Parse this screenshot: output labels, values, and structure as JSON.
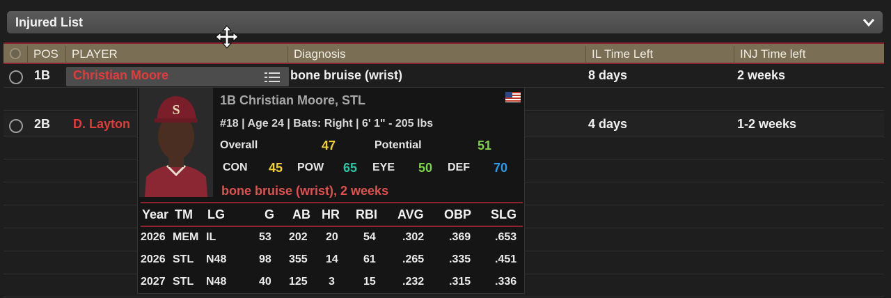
{
  "panel": {
    "title": "Injured List"
  },
  "columns": {
    "pos": "POS",
    "player": "PLAYER",
    "diagnosis": "Diagnosis",
    "il_time": "IL Time Left",
    "inj_time": "INJ Time left"
  },
  "rows": [
    {
      "pos": "1B",
      "player": "Christian Moore",
      "diagnosis": "bone bruise (wrist)",
      "il_time": "8 days",
      "inj_time": "2 weeks"
    },
    {
      "pos": "2B",
      "player": "D. Layton",
      "diagnosis": "",
      "il_time": "4 days",
      "inj_time": "1-2 weeks"
    }
  ],
  "card": {
    "name": "1B Christian Moore, STL",
    "info": "#18 | Age 24 | Bats: Right | 6' 1\" - 205 lbs",
    "overall_label": "Overall",
    "overall": "47",
    "potential_label": "Potential",
    "potential": "51",
    "con_label": "CON",
    "con": "45",
    "pow_label": "POW",
    "pow": "65",
    "eye_label": "EYE",
    "eye": "50",
    "def_label": "DEF",
    "def": "70",
    "injury": "bone bruise (wrist), 2 weeks",
    "colors": {
      "overall": "#f0d22e",
      "potential": "#7fd34a",
      "con": "#f0d22e",
      "pow": "#2ec4a4",
      "eye": "#7fd34a",
      "def": "#2f9be8"
    },
    "stats_headers": [
      "Year",
      "TM",
      "LG",
      "G",
      "AB",
      "HR",
      "RBI",
      "AVG",
      "OBP",
      "SLG"
    ],
    "stats_rows": [
      [
        "2026",
        "MEM",
        "IL",
        "53",
        "202",
        "20",
        "54",
        ".302",
        ".369",
        ".653"
      ],
      [
        "2026",
        "STL",
        "N48",
        "98",
        "355",
        "14",
        "61",
        ".265",
        ".335",
        ".451"
      ],
      [
        "2027",
        "STL",
        "N48",
        "40",
        "125",
        "3",
        "15",
        ".232",
        ".315",
        ".336"
      ]
    ]
  }
}
